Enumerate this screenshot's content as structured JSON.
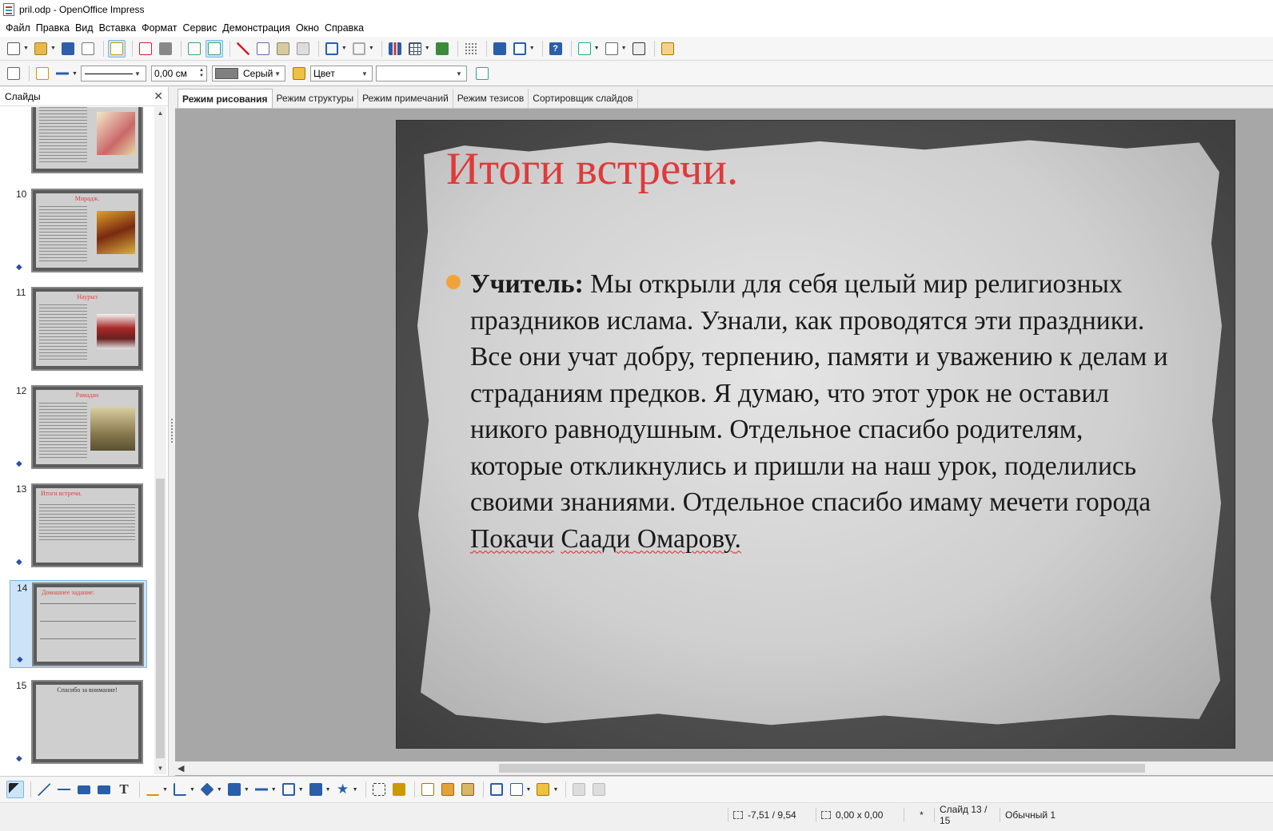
{
  "window": {
    "title": "pril.odp - OpenOffice Impress"
  },
  "menu": [
    "Файл",
    "Правка",
    "Вид",
    "Вставка",
    "Формат",
    "Сервис",
    "Демонстрация",
    "Окно",
    "Справка"
  ],
  "toolbar2": {
    "line_width_value": "0,00 см",
    "line_color_label": "Серый",
    "area_style_label": "Цвет",
    "area_fill_value": ""
  },
  "slides_panel": {
    "title": "Слайды",
    "close_glyph": "✕",
    "thumbnails": [
      {
        "number": "",
        "title": ""
      },
      {
        "number": "10",
        "title": "Мирадж."
      },
      {
        "number": "11",
        "title": "Наурыз"
      },
      {
        "number": "12",
        "title": "Рамадан"
      },
      {
        "number": "13",
        "title": "Итоги встречи."
      },
      {
        "number": "14",
        "title": "Домашнее задание:"
      },
      {
        "number": "15",
        "title": "Спасибо за внимание!"
      }
    ],
    "selected_index": 5
  },
  "view_tabs": [
    "Режим рисования",
    "Режим структуры",
    "Режим примечаний",
    "Режим тезисов",
    "Сортировщик слайдов"
  ],
  "active_tab": "Режим рисования",
  "slide": {
    "title": "Итоги встречи.",
    "body_bold": "Учитель:",
    "body_text": " Мы открыли для себя целый мир религиозных праздников ислама. Узнали, как проводятся эти праздники. Все они учат добру, терпению, памяти и уважению к делам и страданиям предков. Я думаю, что этот урок не оставил никого равнодушным. Отдельное спасибо родителям, которые откликнулись и пришли на наш урок, поделились своими знаниями. Отдельное спасибо имаму мечети города ",
    "spell_word_1": "Покачи",
    "spell_word_2": "Саади",
    "spell_sep": " ",
    "spell_word_3": "Омарову",
    "body_end": ".",
    "title_color": "#e03a3a",
    "bullet_color": "#f2a23a"
  },
  "statusbar": {
    "position": "-7,51 / 9,54",
    "size": "0,00 x 0,00",
    "modified": "*",
    "slide_info": "Слайд 13 / 15",
    "master": "Обычный 1"
  },
  "icons": {
    "toolbar1": [
      "new-icon",
      "open-icon",
      "save-icon",
      "email-icon",
      "edit-file-icon",
      "pdf-export-icon",
      "print-icon",
      "spellcheck-icon",
      "autospell-icon",
      "cut-icon",
      "copy-icon",
      "paste-icon",
      "format-paintbrush-icon",
      "undo-icon",
      "redo-icon",
      "chart-icon",
      "table-icon",
      "hyperlink-icon",
      "grid-icon",
      "navigator-icon",
      "zoom-icon",
      "help-icon",
      "slide-icon",
      "layout-icon",
      "slideshow-icon",
      "presentation-icon"
    ],
    "drawing": [
      "select-icon",
      "line-icon",
      "arrow-line-icon",
      "rectangle-icon",
      "ellipse-icon",
      "text-icon",
      "curve-icon",
      "connector-icon",
      "basic-shapes-icon",
      "symbol-shapes-icon",
      "block-arrows-icon",
      "flowchart-icon",
      "callouts-icon",
      "stars-icon",
      "points-icon",
      "glue-icon",
      "fontwork-icon",
      "from-file-icon",
      "gallery-icon",
      "rotate-icon",
      "alignment-icon",
      "arrange-icon",
      "extrusion-icon",
      "shadow-icon"
    ]
  }
}
